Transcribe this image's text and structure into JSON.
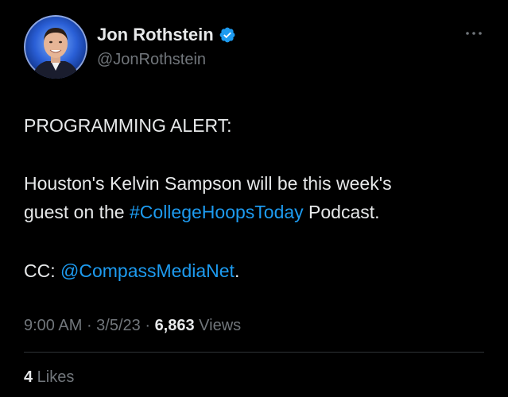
{
  "author": {
    "display_name": "Jon Rothstein",
    "handle": "@JonRothstein",
    "verified_icon": "verified-badge-icon",
    "avatar_icon": "profile-photo"
  },
  "more_icon": "more-horizontal-icon",
  "tweet": {
    "line_alert": "PROGRAMMING ALERT:",
    "line1_text": "Houston's Kelvin Sampson will be this week's",
    "line2_pre": "guest on the ",
    "line2_hashtag": "#CollegeHoopsToday",
    "line2_post": " Podcast.",
    "cc_prefix": "CC: ",
    "cc_mention": "@CompassMediaNet",
    "cc_suffix": "."
  },
  "meta": {
    "time": "9:00 AM",
    "separator": " · ",
    "date": "3/5/23",
    "views_count": "6,863",
    "views_label": " Views"
  },
  "engagement": {
    "likes_count": "4",
    "likes_label": " Likes"
  },
  "colors": {
    "background": "#000000",
    "text": "#e7e9ea",
    "secondary": "#71767b",
    "link": "#1d9bf0",
    "divider": "#2f3336"
  }
}
